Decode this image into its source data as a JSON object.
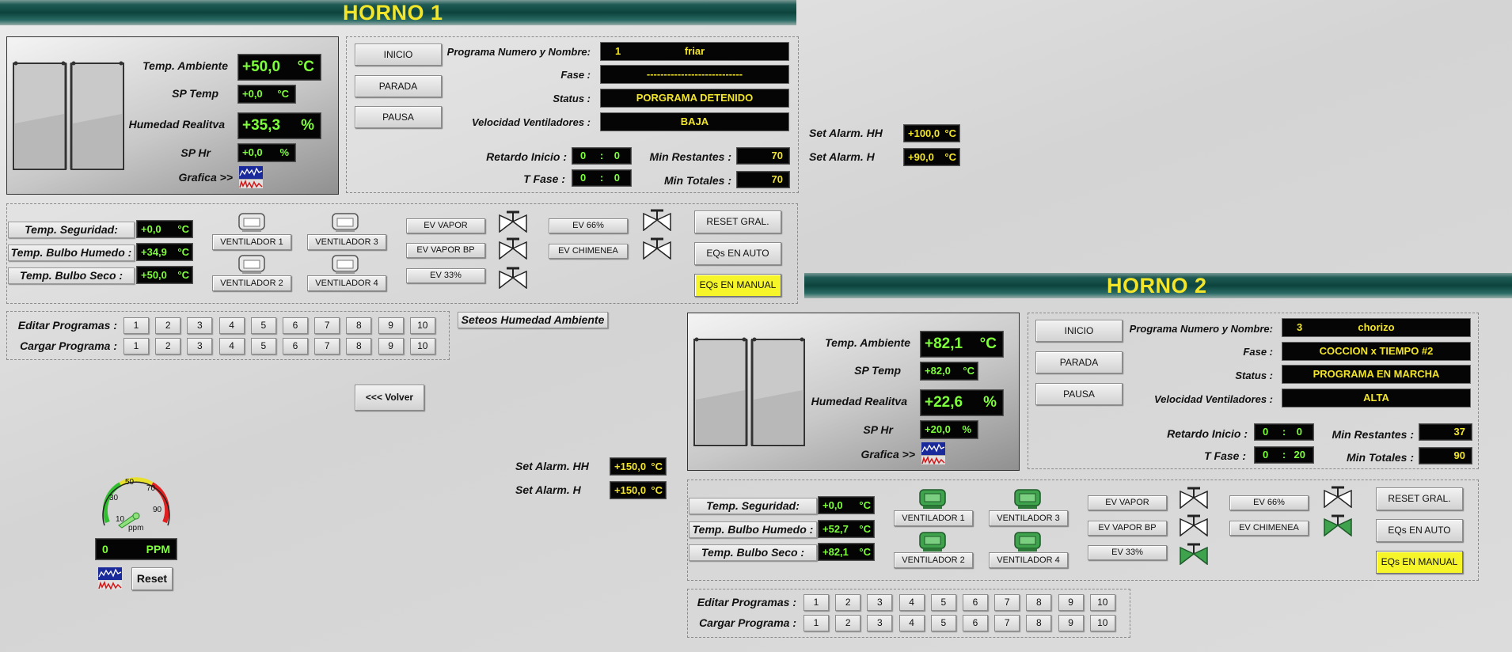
{
  "h1": {
    "title": "HORNO 1",
    "temp_amb_label": "Temp. Ambiente",
    "temp_amb_val": "+50,0",
    "temp_amb_unit": "°C",
    "sp_temp_label": "SP Temp",
    "sp_temp_val": "+0,0",
    "sp_temp_unit": "°C",
    "hum_label": "Humedad Realitva",
    "hum_val": "+35,3",
    "hum_unit": "%",
    "sp_hr_label": "SP Hr",
    "sp_hr_val": "+0,0",
    "sp_hr_unit": "%",
    "grafica_label": "Grafica >>",
    "btn_inicio": "INICIO",
    "btn_parada": "PARADA",
    "btn_pausa": "PAUSA",
    "prog_label": "Programa Numero y Nombre:",
    "prog_num": "1",
    "prog_name": "friar",
    "fase_label": "Fase :",
    "fase_val": "----------------------------",
    "status_label": "Status :",
    "status_val": "PORGRAMA DETENIDO",
    "vel_label": "Velocidad Ventiladores :",
    "vel_val": "BAJA",
    "ret_label": "Retardo Inicio :",
    "ret_a": "0",
    "ret_sep": ":",
    "ret_b": "0",
    "tfase_label": "T Fase :",
    "tfase_a": "0",
    "tfase_sep": ":",
    "tfase_b": "0",
    "minr_label": "Min Restantes :",
    "minr_val": "70",
    "mint_label": "Min Totales :",
    "mint_val": "70",
    "alarm_hh_label": "Set Alarm. HH",
    "alarm_hh_val": "+100,0",
    "alarm_hh_unit": "°C",
    "alarm_h_label": "Set Alarm. H",
    "alarm_h_val": "+90,0",
    "alarm_h_unit": "°C",
    "seg_label": "Temp. Seguridad:",
    "seg_val": "+0,0",
    "seg_unit": "°C",
    "bh_label": "Temp. Bulbo Humedo :",
    "bh_val": "+34,9",
    "bh_unit": "°C",
    "bs_label": "Temp. Bulbo Seco :",
    "bs_val": "+50,0",
    "bs_unit": "°C",
    "vent1": "VENTILADOR 1",
    "vent2": "VENTILADOR 2",
    "vent3": "VENTILADOR 3",
    "vent4": "VENTILADOR 4",
    "ev_vapor": "EV VAPOR",
    "ev_vapor_bp": "EV VAPOR BP",
    "ev_33": "EV 33%",
    "ev_66": "EV  66%",
    "ev_chim": "EV CHIMENEA",
    "reset_gral": "RESET GRAL.",
    "eqs_auto": "EQs EN AUTO",
    "eqs_manual": "EQs EN MANUAL",
    "editar_label": "Editar Programas :",
    "cargar_label": "Cargar Programa :",
    "seteos_label": "Seteos Humedad Ambiente"
  },
  "h2": {
    "title": "HORNO 2",
    "temp_amb_label": "Temp. Ambiente",
    "temp_amb_val": "+82,1",
    "temp_amb_unit": "°C",
    "sp_temp_label": "SP Temp",
    "sp_temp_val": "+82,0",
    "sp_temp_unit": "°C",
    "hum_label": "Humedad Realitva",
    "hum_val": "+22,6",
    "hum_unit": "%",
    "sp_hr_label": "SP Hr",
    "sp_hr_val": "+20,0",
    "sp_hr_unit": "%",
    "grafica_label": "Grafica >>",
    "btn_inicio": "INICIO",
    "btn_parada": "PARADA",
    "btn_pausa": "PAUSA",
    "prog_label": "Programa Numero y Nombre:",
    "prog_num": "3",
    "prog_name": "chorizo",
    "fase_label": "Fase :",
    "fase_val": "COCCION x TIEMPO #2",
    "status_label": "Status :",
    "status_val": "PROGRAMA EN MARCHA",
    "vel_label": "Velocidad Ventiladores :",
    "vel_val": "ALTA",
    "ret_label": "Retardo Inicio :",
    "ret_a": "0",
    "ret_sep": ":",
    "ret_b": "0",
    "tfase_label": "T Fase :",
    "tfase_a": "0",
    "tfase_sep": ":",
    "tfase_b": "20",
    "minr_label": "Min Restantes :",
    "minr_val": "37",
    "mint_label": "Min Totales :",
    "mint_val": "90",
    "alarm_hh_label": "Set Alarm. HH",
    "alarm_hh_val": "+150,0",
    "alarm_hh_unit": "°C",
    "alarm_h_label": "Set Alarm. H",
    "alarm_h_val": "+150,0",
    "alarm_h_unit": "°C",
    "seg_label": "Temp. Seguridad:",
    "seg_val": "+0,0",
    "seg_unit": "°C",
    "bh_label": "Temp. Bulbo Humedo :",
    "bh_val": "+52,7",
    "bh_unit": "°C",
    "bs_label": "Temp. Bulbo Seco :",
    "bs_val": "+82,1",
    "bs_unit": "°C",
    "vent1": "VENTILADOR 1",
    "vent2": "VENTILADOR 2",
    "vent3": "VENTILADOR 3",
    "vent4": "VENTILADOR 4",
    "ev_vapor": "EV VAPOR",
    "ev_vapor_bp": "EV VAPOR BP",
    "ev_33": "EV 33%",
    "ev_66": "EV  66%",
    "ev_chim": "EV CHIMENEA",
    "reset_gral": "RESET GRAL.",
    "eqs_auto": "EQs EN AUTO",
    "eqs_manual": "EQs EN MANUAL",
    "editar_label": "Editar Programas :",
    "cargar_label": "Cargar Programa :"
  },
  "program_numbers": [
    "1",
    "2",
    "3",
    "4",
    "5",
    "6",
    "7",
    "8",
    "9",
    "10"
  ],
  "volver": "<<<  Volver",
  "gauge": {
    "ticks": [
      "10",
      "30",
      "50",
      "70",
      "90"
    ],
    "unit": "ppm",
    "display_val": "0",
    "display_unit": "PPM",
    "reset": "Reset"
  },
  "colors": {
    "accent_yellow": "#f2e52a",
    "display_green": "#7dff3a",
    "active_green": "#3fa34d",
    "header_teal": "#0d433d"
  }
}
